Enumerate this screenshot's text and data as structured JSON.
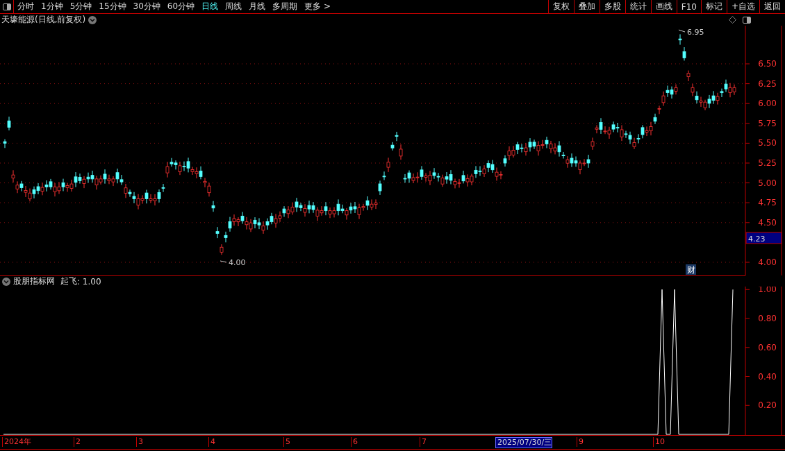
{
  "toolbar": {
    "periods": [
      {
        "label": "分时",
        "selected": false
      },
      {
        "label": "1分钟",
        "selected": false
      },
      {
        "label": "5分钟",
        "selected": false
      },
      {
        "label": "15分钟",
        "selected": false
      },
      {
        "label": "30分钟",
        "selected": false
      },
      {
        "label": "60分钟",
        "selected": false
      },
      {
        "label": "日线",
        "selected": true
      },
      {
        "label": "周线",
        "selected": false
      },
      {
        "label": "月线",
        "selected": false
      },
      {
        "label": "多周期",
        "selected": false
      },
      {
        "label": "更多 >",
        "selected": false
      }
    ],
    "actions": [
      "复权",
      "叠加",
      "多股",
      "统计",
      "画线",
      "F10",
      "标记",
      "+自选",
      "返回"
    ]
  },
  "main_chart": {
    "title": "天壕能源(日线,前复权)",
    "price_axis": [
      "6.50",
      "6.25",
      "6.00",
      "5.75",
      "5.50",
      "5.25",
      "5.00",
      "4.75",
      "4.50",
      "4.00"
    ],
    "current_price": "4.23",
    "high_label": "6.95",
    "low_label": "4.00",
    "badge": "财"
  },
  "indicator": {
    "title": "股朋指标网",
    "value": ": 1.00",
    "chart_data": {
      "type": "line",
      "categories": [
        null,
        null,
        null,
        null,
        null,
        null,
        null,
        null,
        null,
        null,
        null,
        null,
        null,
        null,
        null,
        null,
        null,
        null,
        null,
        null,
        null,
        null,
        null,
        null,
        null,
        null,
        null,
        null,
        null,
        null,
        null,
        null,
        null,
        null,
        null,
        null,
        null,
        null,
        null,
        null,
        null,
        null,
        null,
        null,
        null,
        null,
        null,
        null,
        null,
        null,
        null,
        null,
        null,
        null,
        null,
        null,
        null,
        null,
        null,
        null,
        null,
        null,
        null,
        null,
        null,
        null,
        null,
        null,
        null,
        null,
        null,
        null,
        null,
        null,
        null,
        null,
        null,
        null,
        null,
        null,
        null,
        null,
        null,
        null,
        null,
        null,
        null,
        null,
        null,
        null,
        null,
        null,
        null,
        null,
        null,
        null,
        null,
        null,
        null,
        null,
        null,
        null,
        null,
        null,
        null,
        null,
        null,
        null,
        null,
        null,
        null,
        null,
        null,
        null,
        null,
        null,
        null,
        null,
        null,
        null,
        null,
        null,
        null,
        null,
        null,
        null,
        null,
        null,
        null,
        null,
        null,
        null,
        null,
        null,
        null,
        null,
        null,
        null,
        null,
        null,
        null,
        null,
        null,
        null,
        null,
        null,
        null,
        null,
        null,
        null,
        null,
        null,
        null,
        null,
        null,
        null,
        null,
        null,
        null,
        null,
        null,
        null,
        null,
        null,
        null,
        null,
        null,
        null,
        null,
        null,
        null,
        null,
        null,
        null,
        null,
        null
      ],
      "ylim": [
        0,
        1.02
      ],
      "series": [
        {
          "name": "起飞",
          "color": "#ffffff",
          "values": [
            0,
            0,
            0,
            0,
            0,
            0,
            0,
            0,
            0,
            0,
            0,
            0,
            0,
            0,
            0,
            0,
            0,
            0,
            0,
            0,
            0,
            0,
            0,
            0,
            0,
            0,
            0,
            0,
            0,
            0,
            0,
            0,
            0,
            0,
            0,
            0,
            0,
            0,
            0,
            0,
            0,
            0,
            0,
            0,
            0,
            0,
            0,
            0,
            0,
            0,
            0,
            0,
            0,
            0,
            0,
            0,
            0,
            0,
            0,
            0,
            0,
            0,
            0,
            0,
            0,
            0,
            0,
            0,
            0,
            0,
            0,
            0,
            0,
            0,
            0,
            0,
            0,
            0,
            0,
            0,
            0,
            0,
            0,
            0,
            0,
            0,
            0,
            0,
            0,
            0,
            0,
            0,
            0,
            0,
            0,
            0,
            0,
            0,
            0,
            0,
            0,
            0,
            0,
            0,
            0,
            0,
            0,
            0,
            0,
            0,
            0,
            0,
            0,
            0,
            0,
            0,
            0,
            0,
            0,
            0,
            0,
            0,
            0,
            0,
            0,
            0,
            0,
            0,
            0,
            0,
            0,
            0,
            0,
            0,
            0,
            0,
            0,
            0,
            0,
            0,
            0,
            0,
            0,
            0,
            0,
            0,
            0,
            0,
            0,
            0,
            0,
            0,
            0,
            0,
            0,
            0,
            0,
            0,
            1,
            0,
            0,
            1,
            0,
            0,
            0,
            0,
            0,
            0,
            0,
            0,
            0,
            0,
            0,
            0,
            0,
            1
          ]
        }
      ],
      "yticks": [
        {
          "value": 1,
          "label": "1.00"
        },
        {
          "value": 0.8,
          "label": "0.80"
        },
        {
          "value": 0.6,
          "label": "0.60"
        },
        {
          "value": 0.4,
          "label": "0.40"
        },
        {
          "value": 0.2,
          "label": "0.20"
        }
      ]
    }
  },
  "date_axis": [
    {
      "label": "2024年",
      "selected": false
    },
    {
      "label": "2",
      "selected": false
    },
    {
      "label": "3",
      "selected": false
    },
    {
      "label": "4",
      "selected": false
    },
    {
      "label": "5",
      "selected": false
    },
    {
      "label": "6",
      "selected": false
    },
    {
      "label": "7",
      "selected": false
    },
    {
      "label": "2025/07/30/三",
      "selected": true
    },
    {
      "label": "9",
      "selected": false
    },
    {
      "label": "10",
      "selected": false
    }
  ]
}
